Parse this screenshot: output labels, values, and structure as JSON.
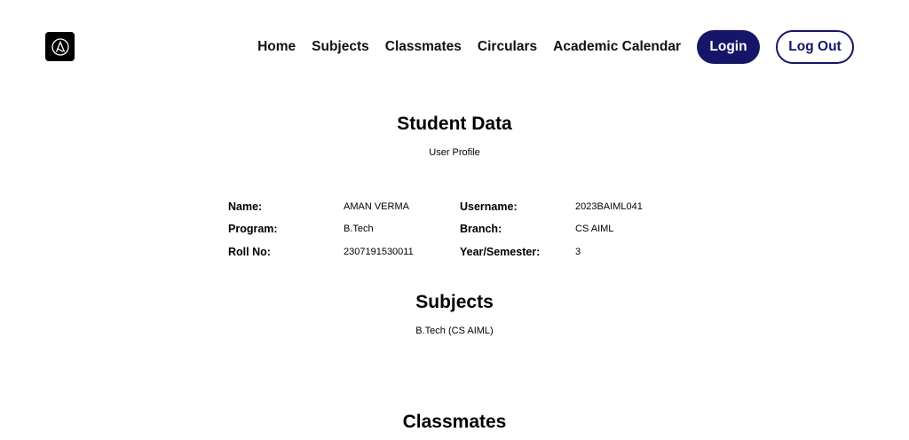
{
  "nav": {
    "links": [
      "Home",
      "Subjects",
      "Classmates",
      "Circulars",
      "Academic Calendar"
    ],
    "login_label": "Login",
    "logout_label": "Log Out"
  },
  "logo": {
    "icon": "logo-icon"
  },
  "student_data": {
    "title": "Student Data",
    "subtitle": "User Profile",
    "fields": [
      {
        "label": "Name:",
        "value": "AMAN VERMA"
      },
      {
        "label": "Username:",
        "value": "2023BAIML041"
      },
      {
        "label": "Program:",
        "value": "B.Tech"
      },
      {
        "label": "Branch:",
        "value": "CS AIML"
      },
      {
        "label": "Roll No:",
        "value": "2307191530011"
      },
      {
        "label": "Year/Semester:",
        "value": "3"
      }
    ]
  },
  "subjects": {
    "title": "Subjects",
    "subtitle": "B.Tech (CS AIML)"
  },
  "classmates": {
    "title": "Classmates"
  },
  "colors": {
    "accent": "#161669",
    "text": "#000000",
    "background": "#ffffff"
  }
}
